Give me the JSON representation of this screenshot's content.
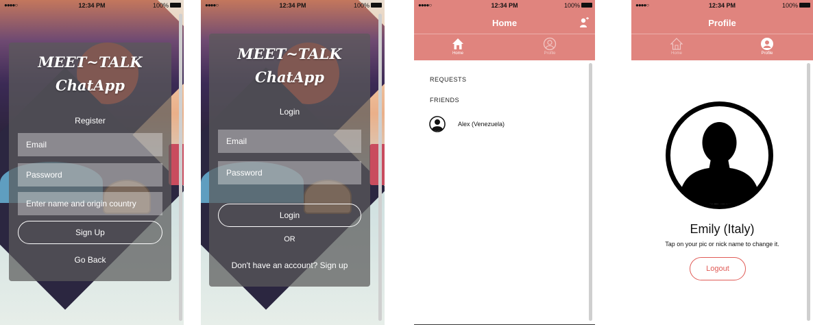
{
  "status": {
    "signal": "●●●●○",
    "time": "12:34 PM",
    "battery": "100%"
  },
  "register": {
    "title_line1": "MEET~TALK",
    "title_line2": "ChatApp",
    "heading": "Register",
    "email_placeholder": "Email",
    "password_placeholder": "Password",
    "name_placeholder": "Enter name and origin country",
    "signup_label": "Sign Up",
    "back_label": "Go Back"
  },
  "login": {
    "title_line1": "MEET~TALK",
    "title_line2": "ChatApp",
    "heading": "Login",
    "email_placeholder": "Email",
    "password_placeholder": "Password",
    "login_label": "Login",
    "or_label": "OR",
    "signup_link": "Don't have an account? Sign up"
  },
  "home": {
    "title": "Home",
    "tabs": [
      {
        "label": "Home",
        "icon": "home-icon"
      },
      {
        "label": "Profile",
        "icon": "profile-icon"
      }
    ],
    "requests_label": "REQUESTS",
    "friends_label": "FRIENDS",
    "friends": [
      {
        "name": "Alex (Venezuela)",
        "icon": "avatar-icon"
      }
    ]
  },
  "profile": {
    "title": "Profile",
    "tabs": [
      {
        "label": "Home",
        "icon": "home-icon"
      },
      {
        "label": "Profile",
        "icon": "profile-icon"
      }
    ],
    "name": "Emily (Italy)",
    "hint": "Tap on your pic or nick name to change it.",
    "logout_label": "Logout"
  },
  "colors": {
    "accent": "#e0847e",
    "logout": "#e05a55",
    "overlay": "#5a5a5a"
  }
}
